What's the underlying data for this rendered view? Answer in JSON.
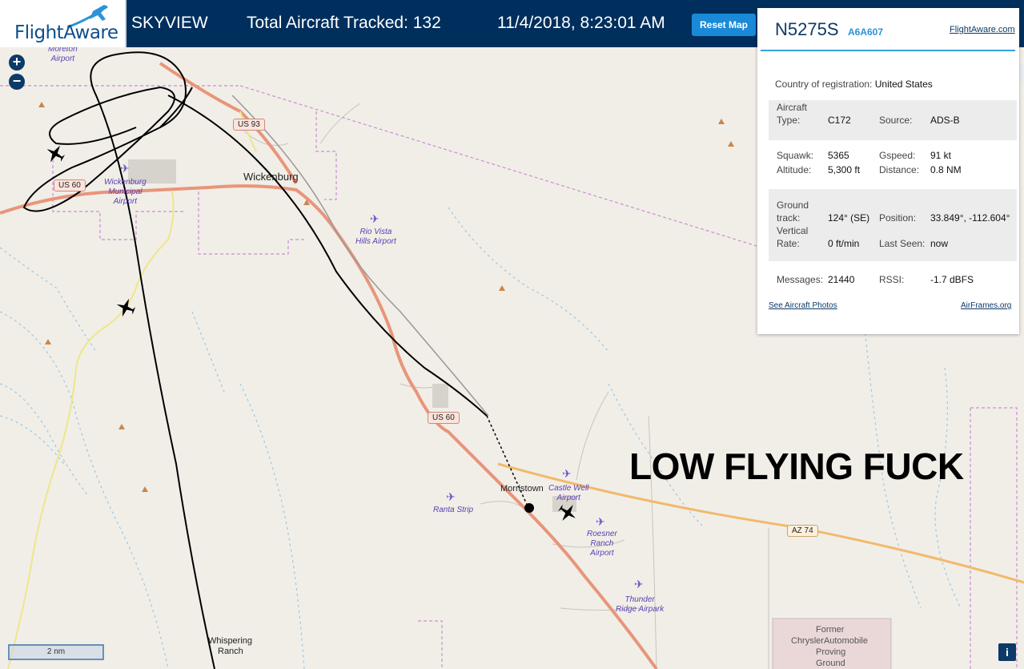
{
  "header": {
    "logo_text": "FlightAware",
    "app_name": "SKYVIEW",
    "tracked_label": "Total Aircraft Tracked: 132",
    "datetime": "11/4/2018, 8:23:01 AM",
    "reset_label": "Reset Map"
  },
  "map": {
    "zoom_in": "+",
    "zoom_out": "−",
    "overlay_text": "LOW FLYING FUCK",
    "scale_label": "2 nm",
    "info_label": "i",
    "places": {
      "wickenburg": "Wickenburg",
      "morristown": "Morristown",
      "whispering_1": "Whispering",
      "whispering_2": "Ranch",
      "former_1": "Former",
      "former_2": "ChryslerAutomobile",
      "former_3": "Proving",
      "former_4": "Ground"
    },
    "airports": {
      "moreton_1": "Moreton",
      "moreton_2": "Airport",
      "wick_1": "Wickenburg",
      "wick_2": "Municipal",
      "wick_3": "Airport",
      "rio_1": "Rio Vista",
      "rio_2": "Hills Airport",
      "castle_1": "Castle Well",
      "castle_2": "Airport",
      "ranta": "Ranta Strip",
      "roesner_1": "Roesner",
      "roesner_2": "Ranch",
      "roesner_3": "Airport",
      "thunder_1": "Thunder",
      "thunder_2": "Ridge Airpark"
    },
    "roads": {
      "us93": "US 93",
      "us60_west": "US 60",
      "us60_south": "US 60",
      "az74": "AZ 74"
    }
  },
  "popup": {
    "registration": "N5275S",
    "hex": "A6A607",
    "fa_link": "FlightAware.com",
    "country_label": "Country of registration:",
    "country_value": "United States",
    "aircraft_type_label_1": "Aircraft",
    "aircraft_type_label_2": "Type:",
    "aircraft_type": "C172",
    "source_label": "Source:",
    "source": "ADS-B",
    "squawk_label": "Squawk:",
    "squawk": "5365",
    "gspeed_label": "Gspeed:",
    "gspeed": "91 kt",
    "altitude_label": "Altitude:",
    "altitude": "5,300 ft",
    "distance_label": "Distance:",
    "distance": "0.8 NM",
    "track_label_1": "Ground",
    "track_label_2": "track:",
    "track": "124° (SE)",
    "position_label": "Position:",
    "position": "33.849°, -112.604°",
    "vrate_label_1": "Vertical",
    "vrate_label_2": "Rate:",
    "vrate": "0 ft/min",
    "lastseen_label": "Last Seen:",
    "lastseen": "now",
    "messages_label": "Messages:",
    "messages": "21440",
    "rssi_label": "RSSI:",
    "rssi": "-1.7 dBFS",
    "photos_link": "See Aircraft Photos",
    "airframes_link": "AirFrames.org"
  },
  "colors": {
    "header_bg": "#002f5d",
    "accent": "#1a8ad8",
    "highway": "#e8957a",
    "state_route": "#f2b96b"
  }
}
